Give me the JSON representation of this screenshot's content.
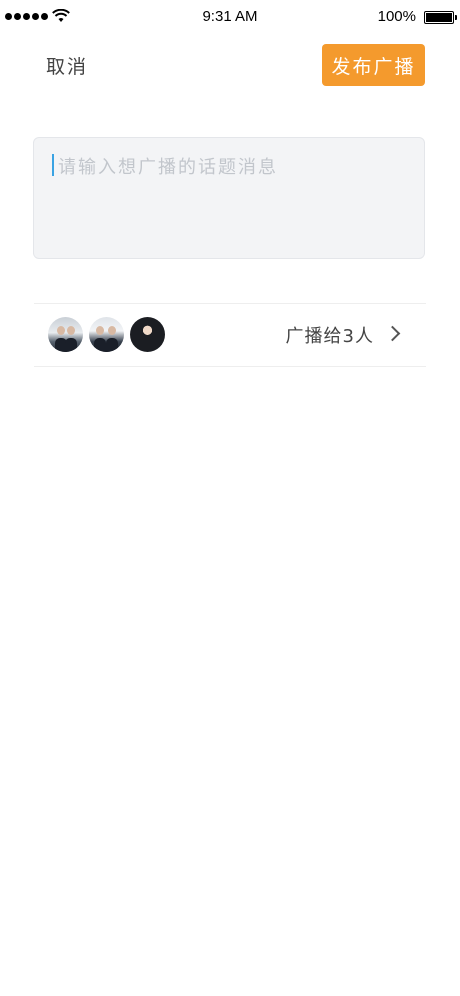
{
  "status_bar": {
    "time": "9:31 AM",
    "battery_percent": "100%",
    "signal_icon": "signal-dots-icon",
    "wifi_icon": "wifi-icon",
    "battery_icon": "battery-icon",
    "battery_level": 1.0
  },
  "header": {
    "cancel_label": "取消",
    "publish_label": "发布广播",
    "publish_color": "#f49a2d"
  },
  "compose": {
    "placeholder": "请输入想广播的话题消息",
    "value": "",
    "caret_color": "#3aa3e3"
  },
  "recipients": {
    "label": "广播给3人",
    "chevron_icon": "chevron-right-icon",
    "avatars": [
      {
        "name": "avatar-1"
      },
      {
        "name": "avatar-2"
      },
      {
        "name": "avatar-3"
      }
    ]
  }
}
